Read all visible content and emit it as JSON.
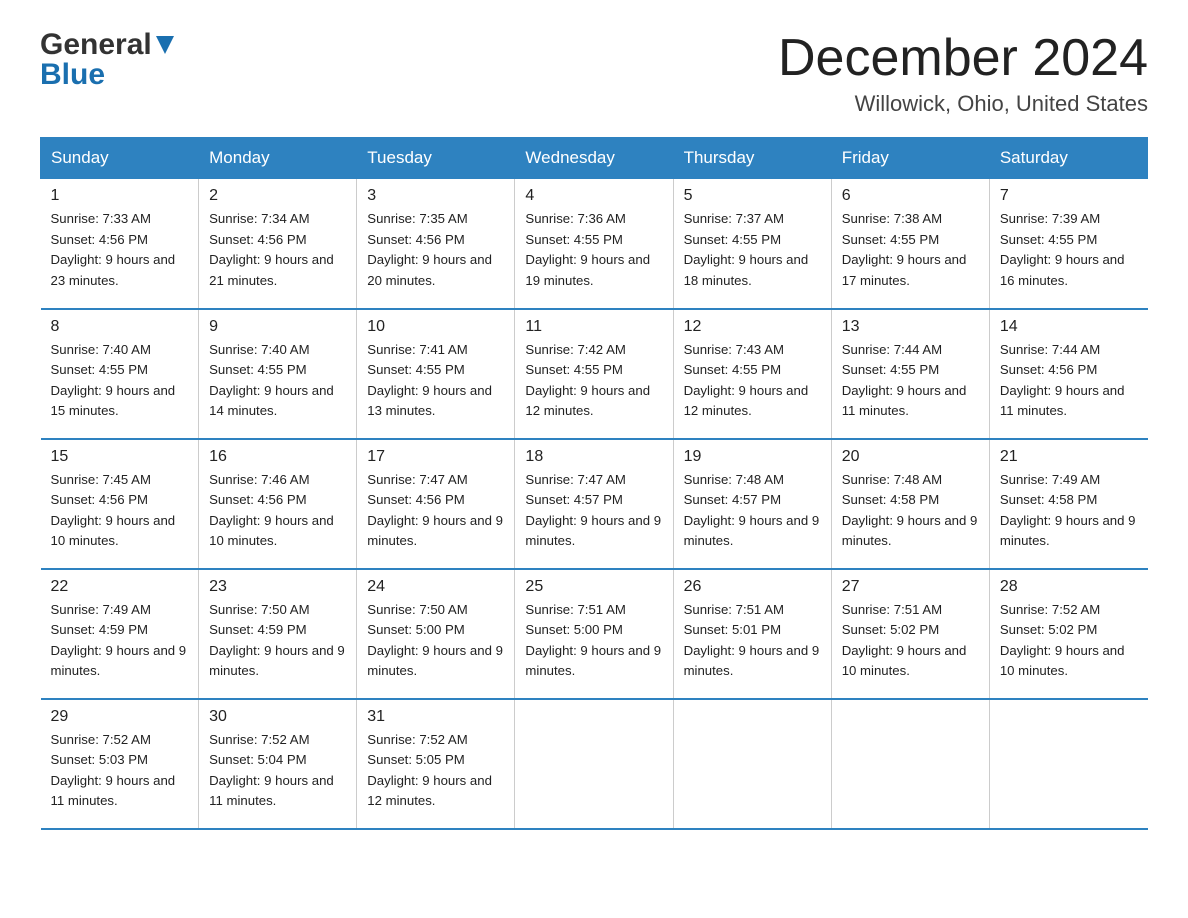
{
  "header": {
    "logo_general": "General",
    "logo_blue": "Blue",
    "month_title": "December 2024",
    "location": "Willowick, Ohio, United States"
  },
  "days_of_week": [
    "Sunday",
    "Monday",
    "Tuesday",
    "Wednesday",
    "Thursday",
    "Friday",
    "Saturday"
  ],
  "weeks": [
    [
      {
        "num": "1",
        "sunrise": "7:33 AM",
        "sunset": "4:56 PM",
        "daylight": "9 hours and 23 minutes."
      },
      {
        "num": "2",
        "sunrise": "7:34 AM",
        "sunset": "4:56 PM",
        "daylight": "9 hours and 21 minutes."
      },
      {
        "num": "3",
        "sunrise": "7:35 AM",
        "sunset": "4:56 PM",
        "daylight": "9 hours and 20 minutes."
      },
      {
        "num": "4",
        "sunrise": "7:36 AM",
        "sunset": "4:55 PM",
        "daylight": "9 hours and 19 minutes."
      },
      {
        "num": "5",
        "sunrise": "7:37 AM",
        "sunset": "4:55 PM",
        "daylight": "9 hours and 18 minutes."
      },
      {
        "num": "6",
        "sunrise": "7:38 AM",
        "sunset": "4:55 PM",
        "daylight": "9 hours and 17 minutes."
      },
      {
        "num": "7",
        "sunrise": "7:39 AM",
        "sunset": "4:55 PM",
        "daylight": "9 hours and 16 minutes."
      }
    ],
    [
      {
        "num": "8",
        "sunrise": "7:40 AM",
        "sunset": "4:55 PM",
        "daylight": "9 hours and 15 minutes."
      },
      {
        "num": "9",
        "sunrise": "7:40 AM",
        "sunset": "4:55 PM",
        "daylight": "9 hours and 14 minutes."
      },
      {
        "num": "10",
        "sunrise": "7:41 AM",
        "sunset": "4:55 PM",
        "daylight": "9 hours and 13 minutes."
      },
      {
        "num": "11",
        "sunrise": "7:42 AM",
        "sunset": "4:55 PM",
        "daylight": "9 hours and 12 minutes."
      },
      {
        "num": "12",
        "sunrise": "7:43 AM",
        "sunset": "4:55 PM",
        "daylight": "9 hours and 12 minutes."
      },
      {
        "num": "13",
        "sunrise": "7:44 AM",
        "sunset": "4:55 PM",
        "daylight": "9 hours and 11 minutes."
      },
      {
        "num": "14",
        "sunrise": "7:44 AM",
        "sunset": "4:56 PM",
        "daylight": "9 hours and 11 minutes."
      }
    ],
    [
      {
        "num": "15",
        "sunrise": "7:45 AM",
        "sunset": "4:56 PM",
        "daylight": "9 hours and 10 minutes."
      },
      {
        "num": "16",
        "sunrise": "7:46 AM",
        "sunset": "4:56 PM",
        "daylight": "9 hours and 10 minutes."
      },
      {
        "num": "17",
        "sunrise": "7:47 AM",
        "sunset": "4:56 PM",
        "daylight": "9 hours and 9 minutes."
      },
      {
        "num": "18",
        "sunrise": "7:47 AM",
        "sunset": "4:57 PM",
        "daylight": "9 hours and 9 minutes."
      },
      {
        "num": "19",
        "sunrise": "7:48 AM",
        "sunset": "4:57 PM",
        "daylight": "9 hours and 9 minutes."
      },
      {
        "num": "20",
        "sunrise": "7:48 AM",
        "sunset": "4:58 PM",
        "daylight": "9 hours and 9 minutes."
      },
      {
        "num": "21",
        "sunrise": "7:49 AM",
        "sunset": "4:58 PM",
        "daylight": "9 hours and 9 minutes."
      }
    ],
    [
      {
        "num": "22",
        "sunrise": "7:49 AM",
        "sunset": "4:59 PM",
        "daylight": "9 hours and 9 minutes."
      },
      {
        "num": "23",
        "sunrise": "7:50 AM",
        "sunset": "4:59 PM",
        "daylight": "9 hours and 9 minutes."
      },
      {
        "num": "24",
        "sunrise": "7:50 AM",
        "sunset": "5:00 PM",
        "daylight": "9 hours and 9 minutes."
      },
      {
        "num": "25",
        "sunrise": "7:51 AM",
        "sunset": "5:00 PM",
        "daylight": "9 hours and 9 minutes."
      },
      {
        "num": "26",
        "sunrise": "7:51 AM",
        "sunset": "5:01 PM",
        "daylight": "9 hours and 9 minutes."
      },
      {
        "num": "27",
        "sunrise": "7:51 AM",
        "sunset": "5:02 PM",
        "daylight": "9 hours and 10 minutes."
      },
      {
        "num": "28",
        "sunrise": "7:52 AM",
        "sunset": "5:02 PM",
        "daylight": "9 hours and 10 minutes."
      }
    ],
    [
      {
        "num": "29",
        "sunrise": "7:52 AM",
        "sunset": "5:03 PM",
        "daylight": "9 hours and 11 minutes."
      },
      {
        "num": "30",
        "sunrise": "7:52 AM",
        "sunset": "5:04 PM",
        "daylight": "9 hours and 11 minutes."
      },
      {
        "num": "31",
        "sunrise": "7:52 AM",
        "sunset": "5:05 PM",
        "daylight": "9 hours and 12 minutes."
      },
      null,
      null,
      null,
      null
    ]
  ],
  "labels": {
    "sunrise": "Sunrise:",
    "sunset": "Sunset:",
    "daylight": "Daylight:"
  }
}
